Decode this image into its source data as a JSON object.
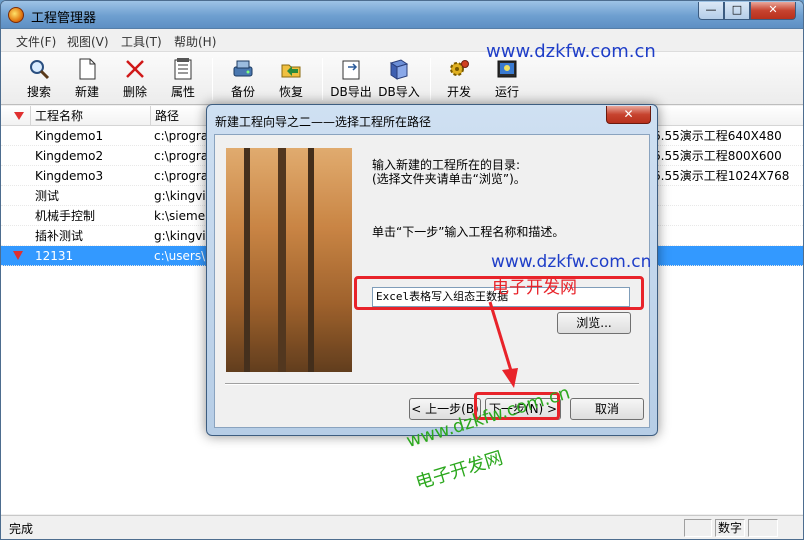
{
  "window": {
    "title": "工程管理器",
    "min_glyph": "—",
    "max_glyph": "□",
    "close_glyph": "✕"
  },
  "menu": [
    "文件(F)",
    "视图(V)",
    "工具(T)",
    "帮助(H)"
  ],
  "toolbar": {
    "search": "搜索",
    "new": "新建",
    "delete": "删除",
    "properties": "属性",
    "backup": "备份",
    "restore": "恢复",
    "db_export": "DB导出",
    "db_import": "DB导入",
    "develop": "开发",
    "run": "运行"
  },
  "table": {
    "headers": [
      "工程名称",
      "路径"
    ],
    "rows": [
      {
        "name": "Kingdemo1",
        "path": "c:\\progra",
        "desc": "6.55演示工程640X480"
      },
      {
        "name": "Kingdemo2",
        "path": "c:\\progra",
        "desc": "6.55演示工程800X600"
      },
      {
        "name": "Kingdemo3",
        "path": "c:\\progra",
        "desc": "6.55演示工程1024X768"
      },
      {
        "name": "测试",
        "path": "g:\\kingvie",
        "desc": ""
      },
      {
        "name": "机械手控制",
        "path": "k:\\siemer",
        "desc": ""
      },
      {
        "name": "插补测试",
        "path": "g:\\kingvie",
        "desc": ""
      },
      {
        "name": "12131",
        "path": "c:\\users\\",
        "desc": ""
      }
    ],
    "selected_row": "12131"
  },
  "status": {
    "text": "完成",
    "numlock": "数字"
  },
  "dialog": {
    "title": "新建工程向导之二——选择工程所在路径",
    "close_glyph": "✕",
    "instruction_line1": "输入新建的工程所在的目录:",
    "instruction_line2": "(选择文件夹请单击“浏览”)。",
    "next_hint": "单击“下一步”输入工程名称和描述。",
    "path_value": "Excel表格写入组态王数据",
    "browse": "浏览...",
    "back": "< 上一步(B)",
    "next": "下一步(N) >",
    "cancel": "取消"
  },
  "watermarks": {
    "url": "www.dzkfw.com.cn",
    "cn_name": "电子开发网"
  }
}
